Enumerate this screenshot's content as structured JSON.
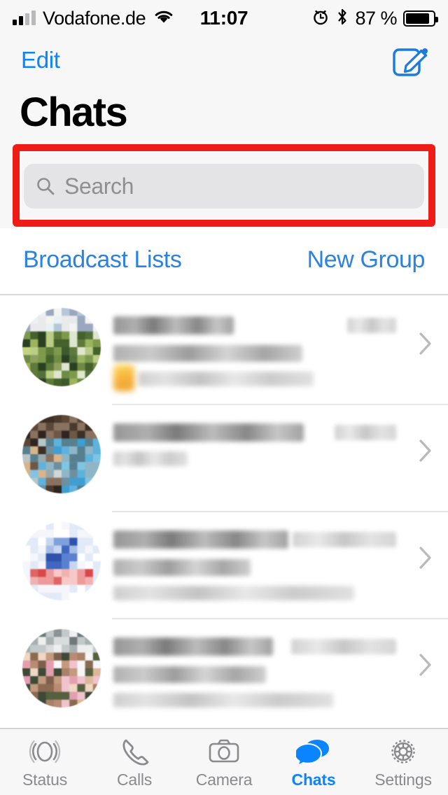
{
  "status_bar": {
    "carrier": "Vodafone.de",
    "time": "11:07",
    "battery_percent": "87 %",
    "signal_icon": "cellular-signal-icon",
    "wifi_icon": "wifi-icon",
    "alarm_icon": "alarm-clock-icon",
    "bluetooth_icon": "bluetooth-icon",
    "battery_icon": "battery-icon",
    "battery_level": 87
  },
  "nav": {
    "edit_label": "Edit",
    "title": "Chats",
    "compose_icon": "compose-icon"
  },
  "search": {
    "placeholder": "Search",
    "value": "",
    "icon": "search-icon",
    "highlight_color": "#ef1b17"
  },
  "actions": {
    "broadcast_label": "Broadcast Lists",
    "new_group_label": "New Group",
    "link_color": "#2c82e0"
  },
  "chats": [
    {
      "name_redacted": true,
      "time_redacted": true,
      "avatar_style": "green-landscape-photo",
      "has_emoji": true,
      "name_width": 172,
      "sub_width": 270,
      "prev_width": 250,
      "time_width": 70,
      "lines": 3
    },
    {
      "name_redacted": true,
      "time_redacted": true,
      "avatar_style": "brown-blue-portrait-photo",
      "has_emoji": false,
      "name_width": 272,
      "sub_width": 0,
      "prev_width": 106,
      "time_width": 88,
      "lines": 2
    },
    {
      "name_redacted": true,
      "time_redacted": true,
      "avatar_style": "blue-red-logo",
      "has_emoji": false,
      "name_width": 250,
      "sub_width": 196,
      "prev_width": 344,
      "time_width": 148,
      "lines": 3
    },
    {
      "name_redacted": true,
      "time_redacted": true,
      "avatar_style": "group-people-photo",
      "has_emoji": false,
      "name_width": 228,
      "sub_width": 218,
      "prev_width": 314,
      "time_width": 150,
      "lines": 3
    }
  ],
  "tabbar": {
    "accent_color": "#0a84ff",
    "inactive_color": "#8a8a8e",
    "items": [
      {
        "label": "Status",
        "icon": "status-rings-icon",
        "active": false
      },
      {
        "label": "Calls",
        "icon": "phone-icon",
        "active": false
      },
      {
        "label": "Camera",
        "icon": "camera-icon",
        "active": false
      },
      {
        "label": "Chats",
        "icon": "chat-bubbles-icon",
        "active": true
      },
      {
        "label": "Settings",
        "icon": "gear-icon",
        "active": false
      }
    ]
  }
}
